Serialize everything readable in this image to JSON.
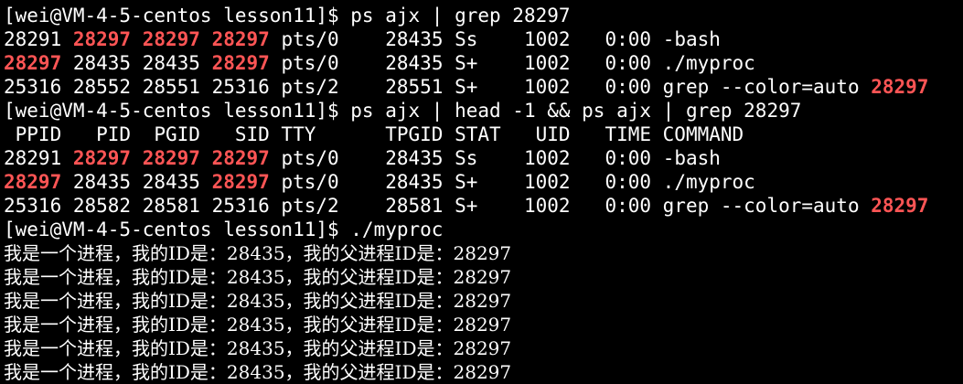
{
  "terminal": {
    "highlight_color": "#ff5555",
    "foreground_color": "#ffffff",
    "background_color": "#000000",
    "lines": [
      [
        {
          "t": "[wei@VM-4-5-centos lesson11]$ ps ajx | grep 28297"
        }
      ],
      [
        {
          "t": "28291 "
        },
        {
          "t": "28297",
          "hl": true
        },
        {
          "t": " "
        },
        {
          "t": "28297",
          "hl": true
        },
        {
          "t": " "
        },
        {
          "t": "28297",
          "hl": true
        },
        {
          "t": " pts/0    28435 Ss    1002   0:00 -bash"
        }
      ],
      [
        {
          "t": "28297",
          "hl": true
        },
        {
          "t": " 28435 28435 "
        },
        {
          "t": "28297",
          "hl": true
        },
        {
          "t": " pts/0    28435 S+    1002   0:00 ./myproc"
        }
      ],
      [
        {
          "t": "25316 28552 28551 25316 pts/2    28551 S+    1002   0:00 grep --color=auto "
        },
        {
          "t": "28297",
          "hl": true
        }
      ],
      [
        {
          "t": "[wei@VM-4-5-centos lesson11]$ ps ajx | head -1 && ps ajx | grep 28297"
        }
      ],
      [
        {
          "t": " PPID   PID  PGID   SID TTY      TPGID STAT   UID   TIME COMMAND"
        }
      ],
      [
        {
          "t": "28291 "
        },
        {
          "t": "28297",
          "hl": true
        },
        {
          "t": " "
        },
        {
          "t": "28297",
          "hl": true
        },
        {
          "t": " "
        },
        {
          "t": "28297",
          "hl": true
        },
        {
          "t": " pts/0    28435 Ss    1002   0:00 -bash"
        }
      ],
      [
        {
          "t": "28297",
          "hl": true
        },
        {
          "t": " 28435 28435 "
        },
        {
          "t": "28297",
          "hl": true
        },
        {
          "t": " pts/0    28435 S+    1002   0:00 ./myproc"
        }
      ],
      [
        {
          "t": "25316 28582 28581 25316 pts/2    28581 S+    1002   0:00 grep --color=auto "
        },
        {
          "t": "28297",
          "hl": true
        }
      ],
      [
        {
          "t": "[wei@VM-4-5-centos lesson11]$ ./myproc"
        }
      ],
      [
        {
          "t": "我是一个进程，我的ID是：28435，我的父进程ID是：28297",
          "zh": true
        }
      ],
      [
        {
          "t": "我是一个进程，我的ID是：28435，我的父进程ID是：28297",
          "zh": true
        }
      ],
      [
        {
          "t": "我是一个进程，我的ID是：28435，我的父进程ID是：28297",
          "zh": true
        }
      ],
      [
        {
          "t": "我是一个进程，我的ID是：28435，我的父进程ID是：28297",
          "zh": true
        }
      ],
      [
        {
          "t": "我是一个进程，我的ID是：28435，我的父进程ID是：28297",
          "zh": true
        }
      ],
      [
        {
          "t": "我是一个进程，我的ID是：28435，我的父进程ID是：28297",
          "zh": true
        }
      ]
    ]
  }
}
